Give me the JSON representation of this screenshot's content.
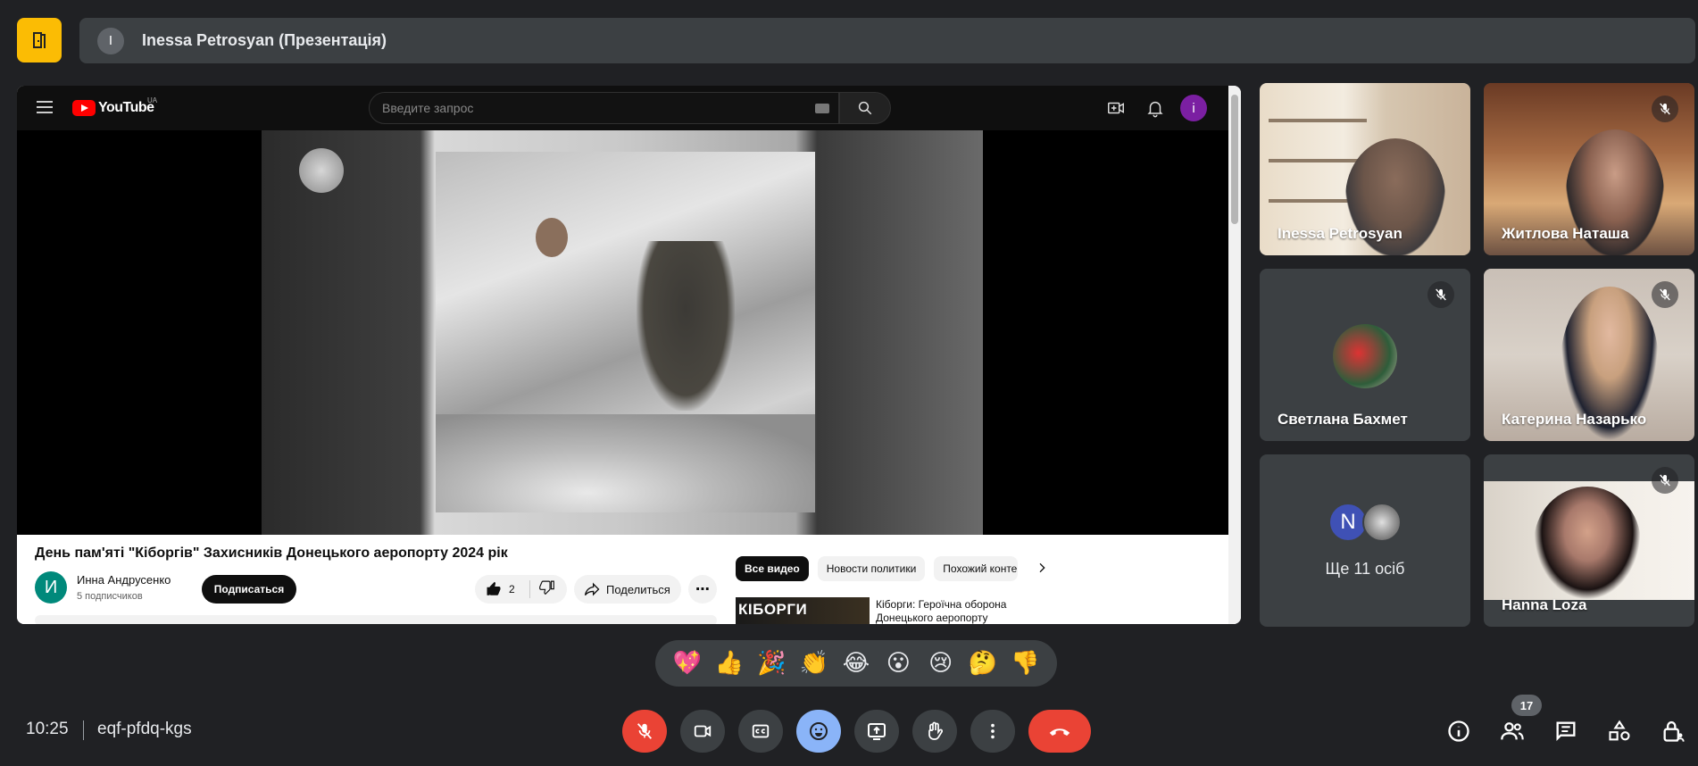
{
  "presenter_bar": {
    "avatar_letter": "I",
    "title": "Inessa Petrosyan (Презентація)"
  },
  "youtube": {
    "logo_text": "YouTube",
    "region": "UA",
    "search_placeholder": "Введите запрос",
    "user_avatar_letter": "i",
    "video_title": "День пам'яті \"Кіборгів\" Захисників Донецького аеропорту 2024 рік",
    "channel": {
      "avatar_letter": "И",
      "name": "Инна Андрусенко",
      "subscribers": "5 подписчиков"
    },
    "subscribe_label": "Подписаться",
    "like_count": "2",
    "share_label": "Поделиться",
    "more_label": "⋯",
    "chips": [
      "Все видео",
      "Новости политики",
      "Похожий контент"
    ],
    "recommendation": {
      "thumb_text": "КІБОРГИ",
      "title": "Кіборги: Героїчна оборона Донецького аеропорту"
    }
  },
  "participants": [
    {
      "name": "Inessa Petrosyan",
      "muted": false
    },
    {
      "name": "Житлова Наташа",
      "muted": true
    },
    {
      "name": "Светлана Бахмет",
      "muted": true
    },
    {
      "name": "Катерина Назарько",
      "muted": true
    },
    {
      "name": "Ще 11 осіб",
      "avatar_letter": "N"
    },
    {
      "name": "Hanna Loza",
      "muted": true
    }
  ],
  "reactions": [
    "💖",
    "👍",
    "🎉",
    "👏",
    "😂",
    "😮",
    "😢",
    "🤔",
    "👎"
  ],
  "footer": {
    "time": "10:25",
    "meeting_code": "eqf-pfdq-kgs",
    "people_count": "17"
  },
  "colors": {
    "accent_yellow": "#fbbc04",
    "danger_red": "#ea4335",
    "active_blue": "#8ab4f8",
    "bg": "#202124"
  }
}
